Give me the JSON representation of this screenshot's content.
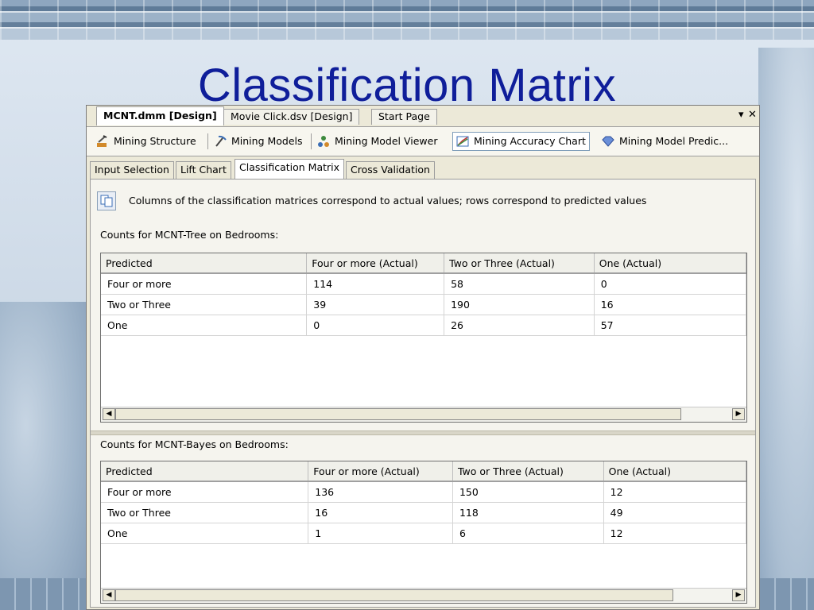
{
  "slide": {
    "title": "Classification Matrix"
  },
  "window": {
    "doc_tabs": [
      {
        "label": "MCNT.dmm [Design]",
        "active": true
      },
      {
        "label": "Movie Click.dsv [Design]",
        "active": false
      },
      {
        "label": "Start Page",
        "active": false
      }
    ],
    "controls": {
      "dropdown": "▾",
      "close": "✕"
    },
    "designer_tabs": [
      {
        "label": "Mining Structure",
        "icon": "pickaxe-cart-icon"
      },
      {
        "label": "Mining Models",
        "icon": "pickaxe-icon"
      },
      {
        "label": "Mining Model Viewer",
        "icon": "model-viewer-icon"
      },
      {
        "label": "Mining Accuracy Chart",
        "icon": "accuracy-chart-icon",
        "active": true
      },
      {
        "label": "Mining Model Predic...",
        "icon": "diamond-icon"
      }
    ],
    "sub_tabs": [
      {
        "label": "Input Selection"
      },
      {
        "label": "Lift Chart"
      },
      {
        "label": "Classification Matrix",
        "active": true
      },
      {
        "label": "Cross Validation"
      }
    ]
  },
  "info": {
    "text": "Columns of the classification matrices correspond to actual values; rows correspond to predicted values",
    "icon": "copy-icon"
  },
  "matrix1": {
    "caption": "Counts for MCNT-Tree on Bedrooms:",
    "headers": [
      "Predicted",
      "Four or more (Actual)",
      "Two or Three (Actual)",
      "One (Actual)"
    ],
    "rows": [
      [
        "Four or more",
        "114",
        "58",
        "0"
      ],
      [
        "Two or Three",
        "39",
        "190",
        "16"
      ],
      [
        "One",
        "0",
        "26",
        "57"
      ]
    ]
  },
  "matrix2": {
    "caption": "Counts for MCNT-Bayes on Bedrooms:",
    "headers": [
      "Predicted",
      "Four or more (Actual)",
      "Two or Three (Actual)",
      "One (Actual)"
    ],
    "rows": [
      [
        "Four or more",
        "136",
        "150",
        "12"
      ],
      [
        "Two or Three",
        "16",
        "118",
        "49"
      ],
      [
        "One",
        "1",
        "6",
        "12"
      ]
    ]
  },
  "scroll": {
    "left": "◀",
    "right": "▶"
  },
  "colors": {
    "title": "#0f1e9a",
    "window_bg": "#ece9d8"
  }
}
